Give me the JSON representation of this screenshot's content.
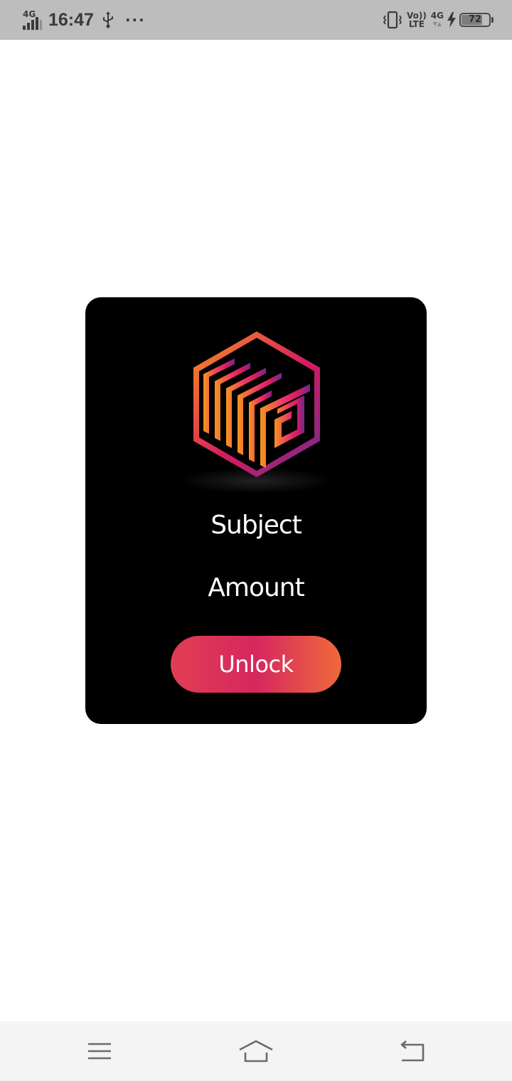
{
  "status_bar": {
    "network_type": "4G",
    "time": "16:47",
    "more": "···",
    "volte_top": "Vo))",
    "volte_bottom": "LTE",
    "data_type": "4G",
    "data_arrows": "▼▲",
    "battery_level": "72"
  },
  "card": {
    "subject": "Subject",
    "amount": "Amount",
    "unlock_label": "Unlock"
  },
  "colors": {
    "status_bar_bg": "#bdbdbd",
    "card_bg": "#000000",
    "button_gradient_start": "#e03e52",
    "button_gradient_mid": "#d6275f",
    "button_gradient_end": "#ef6a3a",
    "logo_orange": "#f7931e",
    "logo_pink": "#d81b60",
    "logo_purple": "#6a2c91"
  },
  "icons": {
    "signal": "signal-icon",
    "usb": "usb-icon",
    "vibrate": "vibrate-icon",
    "charging": "charging-bolt-icon",
    "battery": "battery-icon",
    "logo": "hexagon-mg-logo",
    "menu": "menu-icon",
    "home": "home-icon",
    "back": "back-icon"
  }
}
